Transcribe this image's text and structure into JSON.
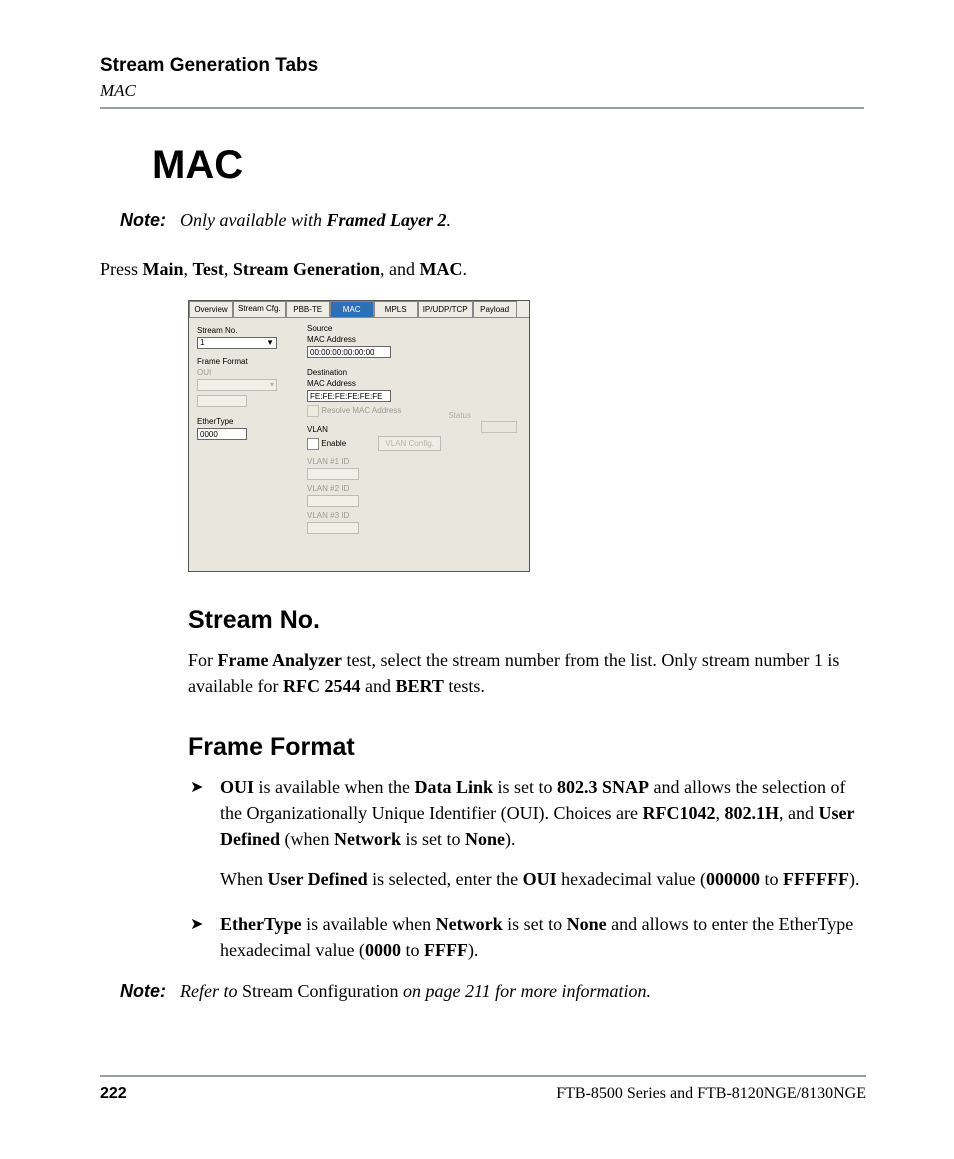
{
  "header": {
    "title": "Stream Generation Tabs",
    "subtitle": "MAC"
  },
  "h1": "MAC",
  "note1": {
    "label": "Note:",
    "before": "Only available with ",
    "bold": "Framed Layer 2",
    "after": "."
  },
  "press": {
    "pre": "Press ",
    "b1": "Main",
    "sep1": ", ",
    "b2": "Test",
    "sep2": ", ",
    "b3": "Stream Generation",
    "sep3": ", and ",
    "b4": "MAC",
    "post": "."
  },
  "shot": {
    "tabs": [
      "Overview",
      "Stream Cfg.",
      "PBB-TE",
      "MAC",
      "MPLS",
      "IP/UDP/TCP",
      "Payload"
    ],
    "left": {
      "streamNoLabel": "Stream No.",
      "streamNoValue": "1",
      "frameFormatLabel": "Frame Format",
      "ouiLabel": "OUI",
      "etherTypeLabel": "EtherType",
      "etherTypeValue": "0000"
    },
    "right": {
      "sourceTitle": "Source",
      "srcMacLabel": "MAC Address",
      "srcMacValue": "00:00:00:00:00:00",
      "destTitle": "Destination",
      "destMacLabel": "MAC Address",
      "destMacValue": "FE:FE:FE:FE:FE:FE",
      "resolveLabel": "Resolve MAC Address",
      "statusLabel": "Status",
      "vlanTitle": "VLAN",
      "enableLabel": "Enable",
      "vlanConfigBtn": "VLAN Config.",
      "vlan1": "VLAN #1 ID",
      "vlan2": "VLAN #2 ID",
      "vlan3": "VLAN #3 ID"
    }
  },
  "streamNoSection": {
    "title": "Stream No.",
    "p_before": "For ",
    "p_b1": "Frame Analyzer",
    "p_mid": " test, select the stream number from the list. Only stream number 1 is available for ",
    "p_b2": "RFC 2544",
    "p_and": " and ",
    "p_b3": "BERT",
    "p_after": " tests."
  },
  "frameFormatSection": {
    "title": "Frame Format",
    "oui": {
      "b1": "OUI",
      "t1": " is available when the ",
      "b2": "Data Link",
      "t2": " is set to ",
      "b3": "802.3 SNAP",
      "t3": " and allows the selection of the Organizationally Unique Identifier (OUI). Choices are ",
      "b4": "RFC1042",
      "t4": ", ",
      "b5": "802.1H",
      "t5": ", and ",
      "b6": "User Defined",
      "t6": " (when ",
      "b7": "Network",
      "t7": " is set to ",
      "b8": "None",
      "t8": ").",
      "s_t1": "When ",
      "s_b1": "User Defined",
      "s_t2": " is selected, enter the ",
      "s_b2": "OUI",
      "s_t3": " hexadecimal value (",
      "s_b3": "000000",
      "s_t4": " to ",
      "s_b4": "FFFFFF",
      "s_t5": ")."
    },
    "ether": {
      "b1": "EtherType",
      "t1": " is available when ",
      "b2": "Network",
      "t2": " is set to ",
      "b3": "None",
      "t3": " and allows to enter the EtherType hexadecimal value (",
      "b4": "0000",
      "t4": " to ",
      "b5": "FFFF",
      "t5": ")."
    }
  },
  "note2": {
    "label": "Note:",
    "t1": "Refer to ",
    "plain": "Stream Configuration",
    "t2": " on page 211 for more information."
  },
  "footer": {
    "page": "222",
    "product": "FTB-8500 Series and FTB-8120NGE/8130NGE"
  }
}
